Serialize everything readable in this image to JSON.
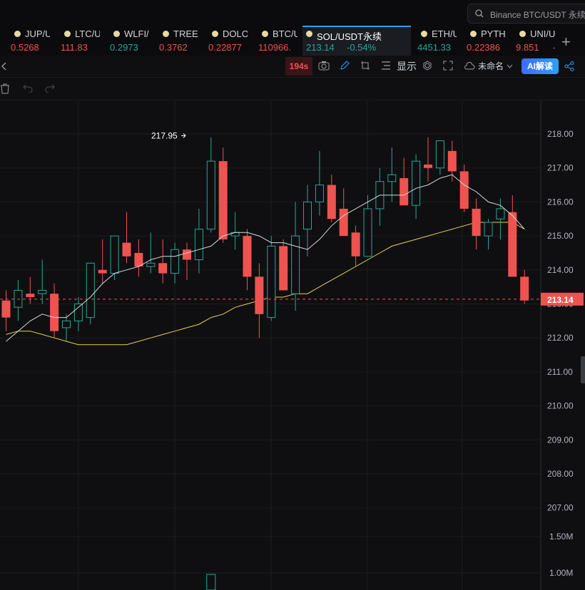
{
  "search": {
    "placeholder": "Binance BTC/USDT 永续"
  },
  "tabs": [
    {
      "symbol": "JUP/USDT",
      "price": "0.5268",
      "change": "",
      "dir": "down"
    },
    {
      "symbol": "LTC/USDT",
      "price": "111.83",
      "change": "",
      "dir": "down"
    },
    {
      "symbol": "WLFI/USDT",
      "price": "0.2973",
      "change": "",
      "dir": "up"
    },
    {
      "symbol": "TREE/USDT",
      "price": "0.3762",
      "change": "",
      "dir": "down"
    },
    {
      "symbol": "DOLO/USDT",
      "price": "0.22877",
      "change": "",
      "dir": "down"
    },
    {
      "symbol": "BTC/USDT",
      "price": "110966.",
      "change": "",
      "dir": "down"
    },
    {
      "symbol": "SOL/USDT永续",
      "price": "213.14",
      "change": "-0.54%",
      "dir": "up",
      "active": true
    },
    {
      "symbol": "ETH/USDT",
      "price": "4451.33",
      "change": "",
      "dir": "up"
    },
    {
      "symbol": "PYTH/USDT",
      "price": "0.22386",
      "change": "",
      "dir": "down"
    },
    {
      "symbol": "UNI/USDT",
      "price": "9.851",
      "change": "-",
      "dir": "down"
    }
  ],
  "toolbar": {
    "timer": "194s",
    "display_label": "显示",
    "layout_name": "未命名",
    "ai_label": "AI解读"
  },
  "colors": {
    "up": "#26a69a",
    "down": "#ef5350",
    "ma_short": "#d8d8d8",
    "ma_long": "#e6d44a",
    "accent": "#2aa0ff"
  },
  "chart_data": {
    "type": "candlestick",
    "symbol": "SOL/USDT",
    "ylim": [
      206.4,
      218.6
    ],
    "price_ticks": [
      "218.00",
      "217.00",
      "216.00",
      "215.00",
      "214.00",
      "213.00",
      "212.00",
      "211.00",
      "210.00",
      "209.00",
      "208.00",
      "207.00"
    ],
    "volume_ticks": [
      "1.50M",
      "1.00M"
    ],
    "current_price": "213.14",
    "high_annotation": "217.95",
    "candles": [
      [
        213.1,
        213.4,
        212.2,
        212.6
      ],
      [
        212.9,
        213.7,
        212.5,
        213.4
      ],
      [
        213.3,
        213.8,
        213.0,
        213.2
      ],
      [
        213.3,
        214.3,
        213.0,
        213.4
      ],
      [
        213.3,
        213.6,
        212.0,
        212.2
      ],
      [
        212.3,
        212.7,
        211.9,
        212.5
      ],
      [
        212.5,
        213.2,
        212.2,
        213.0
      ],
      [
        212.6,
        214.0,
        212.4,
        214.2
      ],
      [
        214.0,
        214.9,
        213.6,
        213.9
      ],
      [
        213.9,
        215.0,
        213.7,
        215.0
      ],
      [
        214.8,
        215.7,
        214.2,
        214.4
      ],
      [
        214.5,
        214.9,
        213.8,
        214.1
      ],
      [
        214.1,
        215.1,
        213.9,
        214.2
      ],
      [
        214.2,
        214.9,
        213.6,
        213.9
      ],
      [
        213.9,
        214.8,
        213.6,
        214.6
      ],
      [
        214.6,
        214.8,
        213.7,
        214.3
      ],
      [
        214.3,
        215.8,
        213.9,
        215.2
      ],
      [
        215.2,
        217.9,
        215.1,
        217.2
      ],
      [
        217.2,
        217.6,
        214.8,
        214.9
      ],
      [
        215.0,
        215.7,
        214.6,
        215.1
      ],
      [
        215.0,
        215.2,
        213.4,
        213.8
      ],
      [
        213.8,
        214.2,
        212.0,
        212.7
      ],
      [
        212.6,
        215.0,
        212.5,
        214.7
      ],
      [
        214.7,
        214.9,
        213.4,
        213.4
      ],
      [
        213.3,
        216.0,
        212.8,
        215.0
      ],
      [
        215.2,
        216.5,
        214.4,
        216.0
      ],
      [
        216.0,
        217.5,
        215.6,
        216.5
      ],
      [
        216.5,
        216.8,
        215.4,
        215.5
      ],
      [
        215.8,
        216.4,
        215.1,
        215.0
      ],
      [
        215.1,
        215.3,
        214.1,
        214.4
      ],
      [
        214.4,
        216.2,
        214.4,
        215.8
      ],
      [
        215.8,
        217.0,
        215.3,
        216.6
      ],
      [
        216.6,
        217.6,
        216.0,
        216.8
      ],
      [
        216.7,
        217.3,
        215.9,
        215.9
      ],
      [
        215.9,
        217.4,
        215.5,
        217.2
      ],
      [
        217.1,
        217.9,
        216.6,
        217.0
      ],
      [
        217.0,
        217.5,
        216.8,
        217.8
      ],
      [
        217.5,
        217.8,
        216.6,
        216.9
      ],
      [
        216.9,
        217.1,
        215.7,
        215.8
      ],
      [
        215.8,
        216.1,
        214.6,
        215.0
      ],
      [
        215.0,
        215.5,
        214.6,
        215.4
      ],
      [
        215.5,
        216.1,
        214.9,
        215.8
      ],
      [
        215.7,
        216.2,
        213.8,
        213.8
      ],
      [
        213.8,
        214.0,
        213.0,
        213.1
      ]
    ],
    "ma_short": [
      211.9,
      212.2,
      212.5,
      212.7,
      212.6,
      212.6,
      212.9,
      213.2,
      213.6,
      213.9,
      214.0,
      214.1,
      214.3,
      214.4,
      214.4,
      214.5,
      214.6,
      214.7,
      215.0,
      215.1,
      215.1,
      215.0,
      214.8,
      214.8,
      214.7,
      214.6,
      214.9,
      215.3,
      215.6,
      215.8,
      216.0,
      216.2,
      216.2,
      216.2,
      216.4,
      216.5,
      216.7,
      216.8,
      216.5,
      216.3,
      216.0,
      215.9,
      215.6,
      215.2
    ],
    "ma_long": [
      212.1,
      212.2,
      212.2,
      212.1,
      212.0,
      211.9,
      211.8,
      211.8,
      211.8,
      211.8,
      211.8,
      211.9,
      212.0,
      212.1,
      212.2,
      212.3,
      212.4,
      212.6,
      212.7,
      212.9,
      213.0,
      213.1,
      213.2,
      213.2,
      213.3,
      213.3,
      213.5,
      213.7,
      213.9,
      214.1,
      214.3,
      214.5,
      214.7,
      214.8,
      214.9,
      215.0,
      215.1,
      215.2,
      215.3,
      215.4,
      215.4,
      215.4,
      215.4,
      215.2
    ],
    "volume_visible": [
      {
        "index": 17,
        "value": 0.98
      }
    ]
  }
}
